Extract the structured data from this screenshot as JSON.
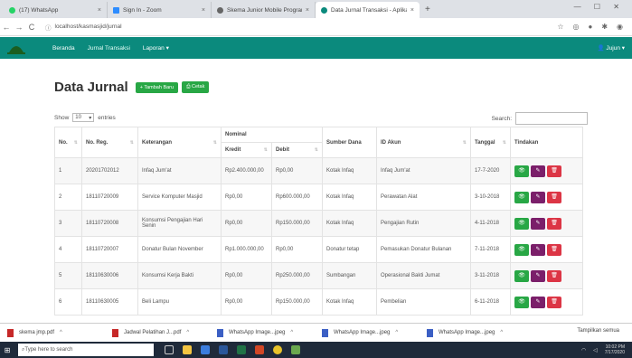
{
  "browser": {
    "tabs": [
      {
        "title": "(17) WhatsApp",
        "color": "#25d366",
        "active": false
      },
      {
        "title": "Sign In - Zoom",
        "color": "#2d8cff",
        "active": false
      },
      {
        "title": "Skema Junior Mobile Programmer",
        "color": "#666666",
        "active": false
      },
      {
        "title": "Data Jurnal Transaksi - Aplikasi K",
        "color": "#0b8a7d",
        "active": true
      }
    ],
    "url": "localhost/kasmasjid/jurnal",
    "back": "←",
    "forward": "→",
    "reload": "C",
    "new_tab": "+"
  },
  "app": {
    "nav": {
      "beranda": "Beranda",
      "jurnal": "Jurnal Transaksi",
      "laporan": "Laporan ▾"
    },
    "user": "Jujun ▾",
    "brand_color": "#0b8a7d"
  },
  "page": {
    "title": "Data Jurnal",
    "add_button": "+ Tambah Baru",
    "print_button": "Cetak",
    "show_label": "Show",
    "show_value": "10",
    "entries_label": "entries",
    "search_label": "Search:"
  },
  "table": {
    "headers": {
      "no": "No.",
      "no_reg": "No. Reg.",
      "keterangan": "Keterangan",
      "nominal": "Nominal",
      "kredit": "Kredit",
      "debit": "Debit",
      "sumber": "Sumber Dana",
      "id_akun": "ID Akun",
      "tanggal": "Tanggal",
      "tindakan": "Tindakan"
    },
    "rows": [
      {
        "no": "1",
        "reg": "20201702012",
        "ket": "Infaq Jum'at",
        "kredit": "Rp2.400.000,00",
        "debit": "Rp0,00",
        "sumber": "Kotak Infaq",
        "akun": "Infaq Jum'at",
        "tgl": "17-7-2020"
      },
      {
        "no": "2",
        "reg": "18110720009",
        "ket": "Service Komputer Masjid",
        "kredit": "Rp0,00",
        "debit": "Rp600.000,00",
        "sumber": "Kotak Infaq",
        "akun": "Perawatan Alat",
        "tgl": "3-10-2018"
      },
      {
        "no": "3",
        "reg": "18110720008",
        "ket": "Konsumsi Pengajian Hari Senin",
        "kredit": "Rp0,00",
        "debit": "Rp150.000,00",
        "sumber": "Kotak Infaq",
        "akun": "Pengajian Rutin",
        "tgl": "4-11-2018"
      },
      {
        "no": "4",
        "reg": "18110720007",
        "ket": "Donatur Bulan November",
        "kredit": "Rp1.000.000,00",
        "debit": "Rp0,00",
        "sumber": "Donatur tetap",
        "akun": "Pemasukan Donatur Bulanan",
        "tgl": "7-11-2018"
      },
      {
        "no": "5",
        "reg": "18110630006",
        "ket": "Konsumsi Kerja Bakti",
        "kredit": "Rp0,00",
        "debit": "Rp250.000,00",
        "sumber": "Sumbangan",
        "akun": "Operasional Bakti Jumat",
        "tgl": "3-11-2018"
      },
      {
        "no": "6",
        "reg": "18110630005",
        "ket": "Beli Lampu",
        "kredit": "Rp0,00",
        "debit": "Rp150.000,00",
        "sumber": "Kotak Infaq",
        "akun": "Pembelian",
        "tgl": "6-11-2018"
      }
    ],
    "actions": {
      "view": "👁",
      "edit": "✎",
      "delete": "🗑"
    }
  },
  "downloads": {
    "items": [
      {
        "name": "skema jmp.pdf",
        "type": "pdf"
      },
      {
        "name": "Jadwal Pelatihan J...pdf",
        "type": "pdf"
      },
      {
        "name": "WhatsApp Image...jpeg",
        "type": "img"
      },
      {
        "name": "WhatsApp Image...jpeg",
        "type": "img"
      },
      {
        "name": "WhatsApp Image...jpeg",
        "type": "img"
      }
    ],
    "show_all": "Tampilkan semua"
  },
  "taskbar": {
    "search_placeholder": "Type here to search",
    "time": "10:02 PM",
    "date": "7/17/2020"
  }
}
